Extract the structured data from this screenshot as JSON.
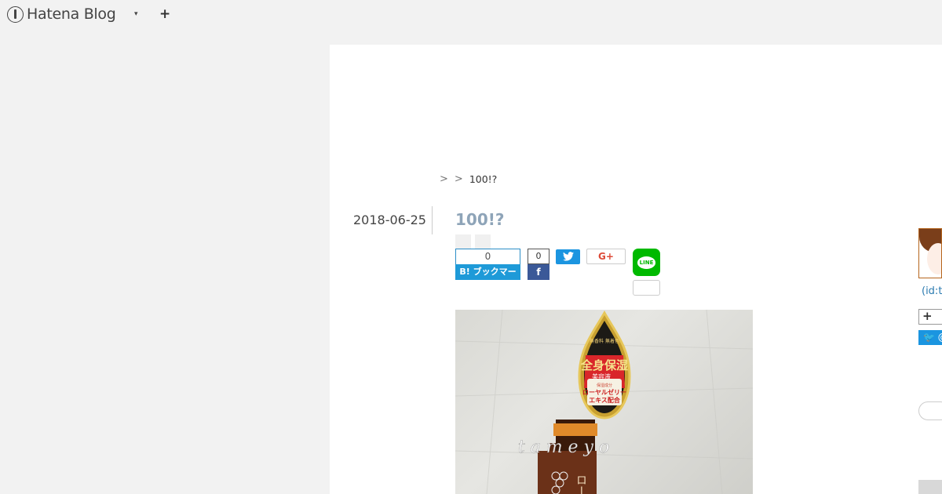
{
  "header": {
    "logo_text": "Hatena Blog",
    "menu_caret": "▾",
    "add_icon": "+"
  },
  "breadcrumb": {
    "sep1": ">",
    "sep2": ">",
    "current": "100!?"
  },
  "entry": {
    "date": "2018-06-25",
    "title": "100!?"
  },
  "share": {
    "hatena_count": "0",
    "hatena_label": "B! ブックマーク",
    "facebook_count": "0",
    "facebook_icon": "f",
    "twitter_icon": "🐦",
    "googleplus_label": "G+",
    "line_label": "LINE"
  },
  "photo": {
    "label_top_small": "無香料 無着色",
    "label_main": "全身保湿",
    "label_sub": "美容液",
    "label_ingredient": "保湿成分",
    "label_royal1": "ローヤルゼリー",
    "label_royal2": "エキス配合",
    "watermark": "t a m e y o"
  },
  "sidebar": {
    "id_text": "(id:t",
    "follow_icon": "+",
    "twitter_follow": "🐦 @"
  },
  "colors": {
    "title": "#8ea4b8",
    "hatena_blue": "#1e9ad8",
    "facebook": "#3b5998",
    "twitter": "#1b95e0",
    "googleplus": "#dd4b39",
    "line": "#00b900",
    "id_link": "#2a7ab0"
  }
}
